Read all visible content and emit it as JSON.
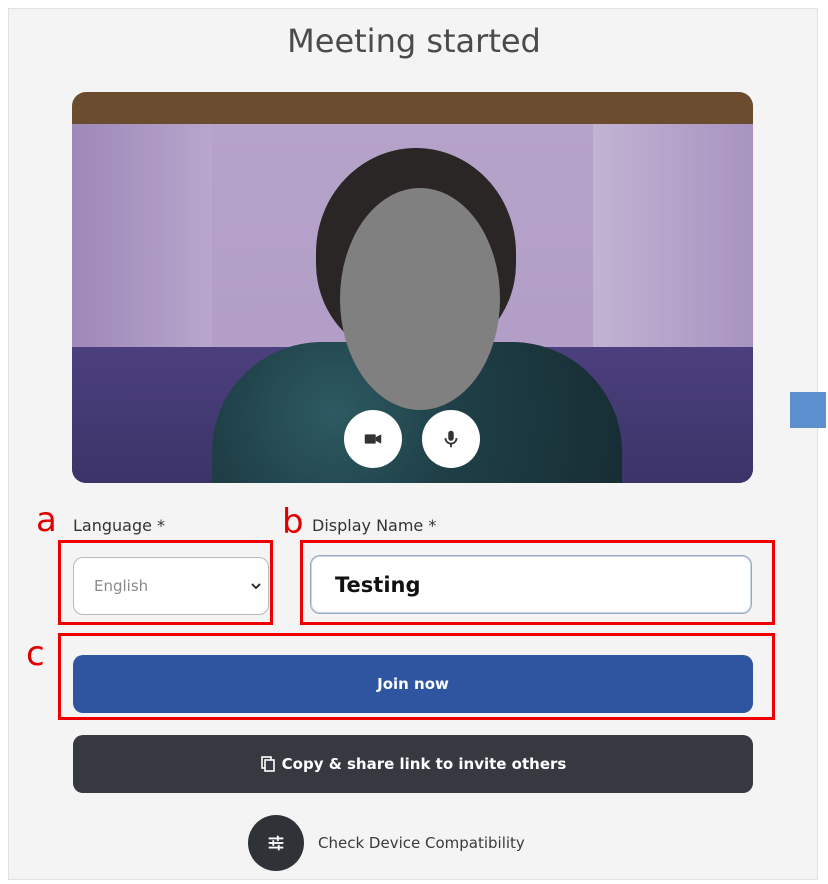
{
  "header": {
    "title": "Meeting started"
  },
  "video": {
    "camera_icon": "video-camera-icon",
    "mic_icon": "microphone-icon"
  },
  "form": {
    "language_label": "Language *",
    "language_value": "English",
    "display_name_label": "Display Name *",
    "display_name_value": "Testing"
  },
  "annotations": {
    "a": "a",
    "b": "b",
    "c": "c"
  },
  "actions": {
    "join_label": "Join now",
    "copy_label": "Copy & share link to invite others",
    "compat_label": "Check Device Compatibility"
  },
  "colors": {
    "primary": "#2f55a0",
    "dark": "#363a40",
    "annotation": "#ee0000"
  }
}
